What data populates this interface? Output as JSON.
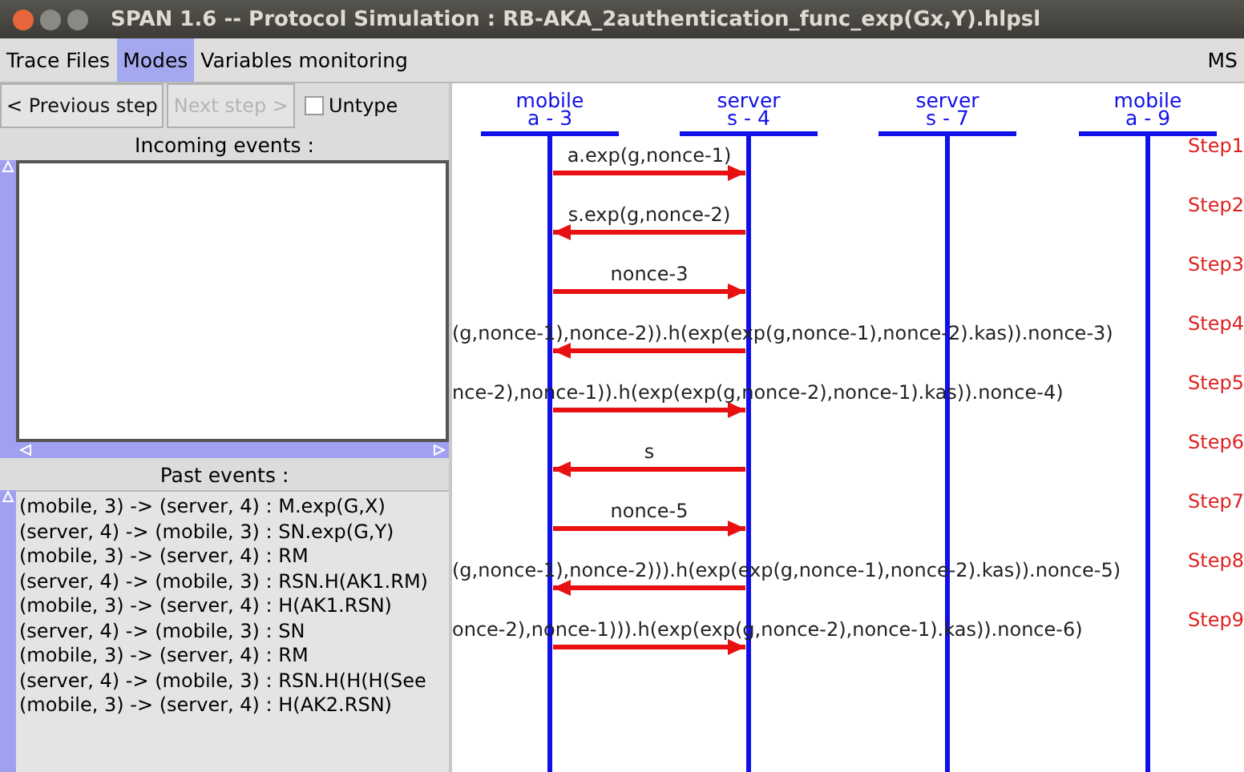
{
  "window": {
    "title": "SPAN 1.6 -- Protocol Simulation : RB-AKA_2authentication_func_exp(Gx,Y).hlpsl"
  },
  "menu": [
    {
      "label": "Trace Files",
      "selected": false
    },
    {
      "label": "Modes",
      "selected": true
    },
    {
      "label": "Variables monitoring",
      "selected": false
    }
  ],
  "menu_right": {
    "label": "MS"
  },
  "toolbar": {
    "previous": {
      "label": "< Previous step",
      "disabled": false
    },
    "next": {
      "label": "Next step >",
      "disabled": true
    },
    "untype": {
      "label": "Untype",
      "checked": false
    }
  },
  "incoming": {
    "title": "Incoming events :"
  },
  "past": {
    "title": "Past events :",
    "items": [
      "(mobile, 3) -> (server, 4) : M.exp(G,X)",
      "(server, 4) -> (mobile, 3) : SN.exp(G,Y)",
      "(mobile, 3) -> (server, 4) : RM",
      "(server, 4) -> (mobile, 3) : RSN.H(AK1.RM)",
      "(mobile, 3) -> (server, 4) : H(AK1.RSN)",
      "(server, 4) -> (mobile, 3) : SN",
      "(mobile, 3) -> (server, 4) : RM",
      "(server, 4) -> (mobile, 3) : RSN.H(H(H(See",
      "(mobile, 3) -> (server, 4) : H(AK2.RSN)"
    ]
  },
  "diagram": {
    "lifelines": [
      {
        "name": "mobile",
        "id": "a - 3"
      },
      {
        "name": "server",
        "id": "s - 4"
      },
      {
        "name": "server",
        "id": "s - 7"
      },
      {
        "name": "mobile",
        "id": "a - 9"
      }
    ],
    "messages": [
      {
        "label": "a.exp(g,nonce-1)",
        "kind": "rightward",
        "step": "Step1"
      },
      {
        "label": "s.exp(g,nonce-2)",
        "kind": "leftward",
        "step": "Step2"
      },
      {
        "label": "nonce-3",
        "kind": "rightward",
        "step": "Step3"
      },
      {
        "label": "(g,nonce-1),nonce-2)).h(exp(exp(g,nonce-1),nonce-2).kas)).nonce-3)",
        "kind": "leftward",
        "step": "Step4"
      },
      {
        "label": "nce-2),nonce-1)).h(exp(exp(g,nonce-2),nonce-1).kas)).nonce-4)",
        "kind": "rightward",
        "step": "Step5"
      },
      {
        "label": "s",
        "kind": "leftward",
        "step": "Step6"
      },
      {
        "label": "nonce-5",
        "kind": "rightward",
        "step": "Step7"
      },
      {
        "label": "(g,nonce-1),nonce-2))).h(exp(exp(g,nonce-1),nonce-2).kas)).nonce-5)",
        "kind": "leftward",
        "step": "Step8"
      },
      {
        "label": "once-2),nonce-1))).h(exp(exp(g,nonce-2),nonce-1).kas)).nonce-6)",
        "kind": "rightward",
        "step": "Step9"
      }
    ]
  }
}
